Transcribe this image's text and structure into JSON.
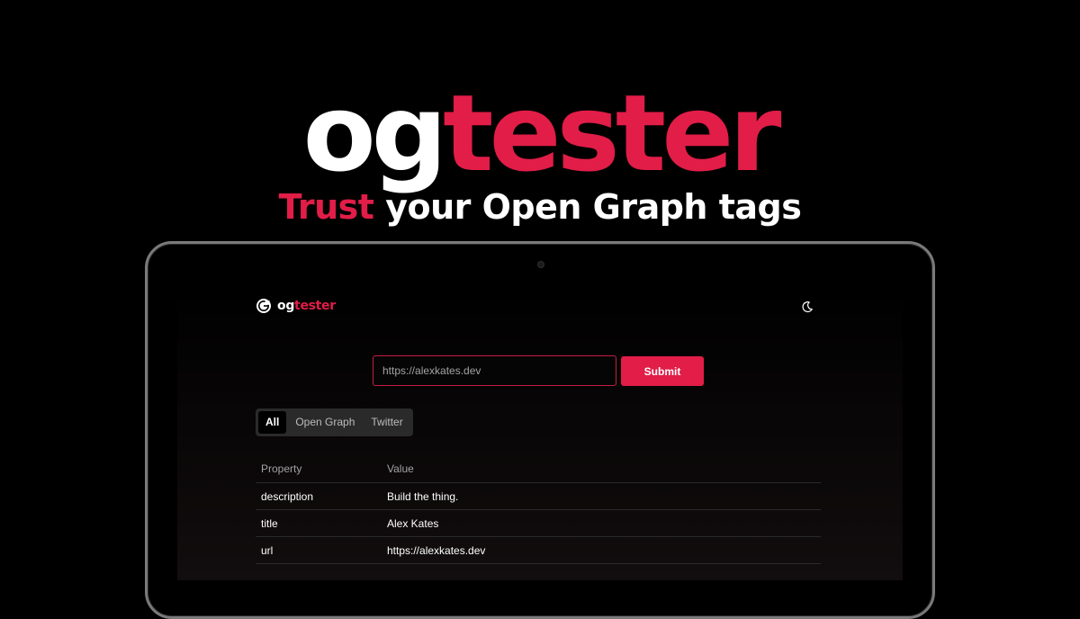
{
  "hero": {
    "logo_og": "og",
    "logo_tester": "tester",
    "tagline_accent": "Trust",
    "tagline_rest": " your Open Graph tags"
  },
  "app": {
    "logo_og": "og",
    "logo_tester": "tester",
    "theme_toggle_icon": "moon-icon"
  },
  "form": {
    "url_value": "",
    "url_placeholder": "https://alexkates.dev",
    "submit_label": "Submit"
  },
  "tabs": [
    {
      "label": "All",
      "active": true
    },
    {
      "label": "Open Graph",
      "active": false
    },
    {
      "label": "Twitter",
      "active": false
    }
  ],
  "table": {
    "headers": [
      "Property",
      "Value"
    ],
    "rows": [
      {
        "property": "description",
        "value": "Build the thing."
      },
      {
        "property": "title",
        "value": "Alex Kates"
      },
      {
        "property": "url",
        "value": "https://alexkates.dev"
      }
    ]
  },
  "colors": {
    "brand": "#e11d48",
    "background": "#000000",
    "text": "#ffffff",
    "muted": "#a3a3a3"
  }
}
